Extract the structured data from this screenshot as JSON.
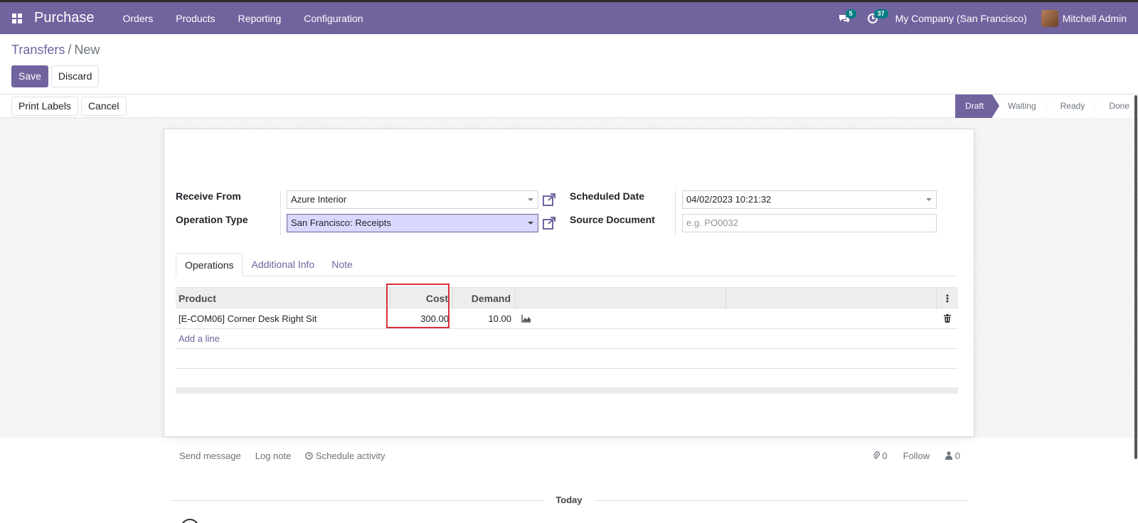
{
  "app": {
    "name": "Purchase",
    "menu": [
      "Orders",
      "Products",
      "Reporting",
      "Configuration"
    ],
    "messages_badge": "5",
    "activities_badge": "37",
    "company": "My Company (San Francisco)",
    "user": "Mitchell Admin"
  },
  "breadcrumb": {
    "parent": "Transfers",
    "separator": "/",
    "current": "New"
  },
  "actions": {
    "save": "Save",
    "discard": "Discard",
    "print_labels": "Print Labels",
    "cancel": "Cancel"
  },
  "stages": [
    "Draft",
    "Waiting",
    "Ready",
    "Done"
  ],
  "form": {
    "receive_from_label": "Receive From",
    "receive_from_value": "Azure Interior",
    "operation_type_label": "Operation Type",
    "operation_type_value": "San Francisco: Receipts",
    "scheduled_date_label": "Scheduled Date",
    "scheduled_date_value": "04/02/2023 10:21:32",
    "source_document_label": "Source Document",
    "source_document_placeholder": "e.g. PO0032"
  },
  "tabs": [
    "Operations",
    "Additional Info",
    "Note"
  ],
  "grid": {
    "headers": {
      "product": "Product",
      "cost": "Cost",
      "demand": "Demand"
    },
    "rows": [
      {
        "product": "[E-COM06] Corner Desk Right Sit",
        "cost": "300.00",
        "demand": "10.00"
      }
    ],
    "add_line": "Add a line"
  },
  "chatter": {
    "send_message": "Send message",
    "log_note": "Log note",
    "schedule_activity": "Schedule activity",
    "attachments_count": "0",
    "follow": "Follow",
    "followers_count": "0",
    "today": "Today"
  },
  "colors": {
    "brand": "#71639e",
    "highlight": "#d9303c",
    "badge": "#017e84"
  }
}
